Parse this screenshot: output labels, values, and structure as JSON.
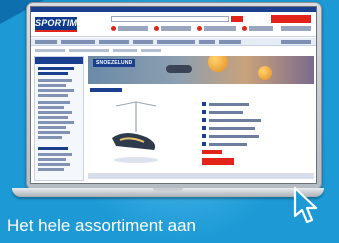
{
  "brand": {
    "logo_text": "SPORTIME",
    "accent_red": "#e2231a",
    "brand_blue": "#1a3f8f",
    "background_blue": "#1d9ad6"
  },
  "banner": {
    "label": "SNOEZELUND"
  },
  "caption": "Het hele assortiment aan",
  "icons": [
    "laptop-icon",
    "mouse-cursor-icon"
  ]
}
